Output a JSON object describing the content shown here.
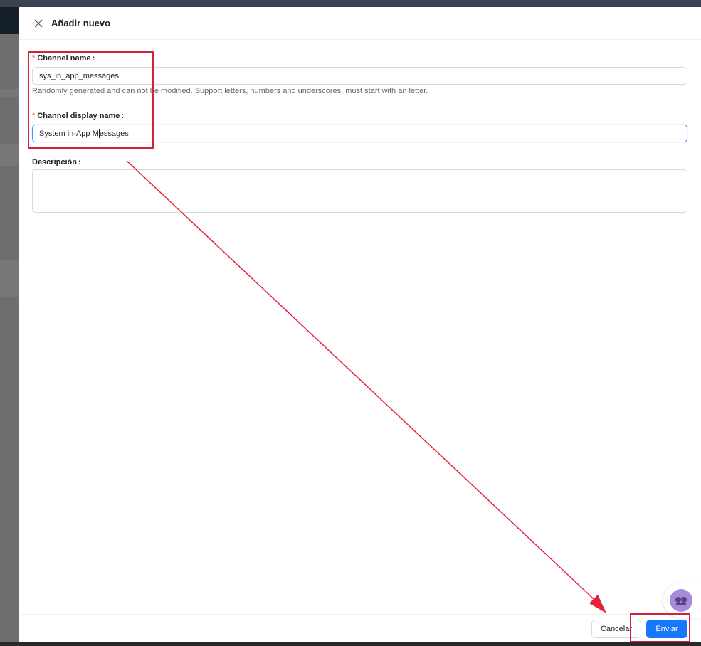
{
  "drawer": {
    "title": "Añadir nuevo",
    "close_icon": "close-icon"
  },
  "form": {
    "channel_name": {
      "label": "Channel name",
      "required": true,
      "value": "sys_in_app_messages",
      "help": "Randomly generated and can not be modified. Support letters, numbers and underscores, must start with an letter."
    },
    "channel_display_name": {
      "label": "Channel display name",
      "required": true,
      "value_before_caret": "System in-App M",
      "value_after_caret": "essages"
    },
    "description": {
      "label": "Descripción",
      "value": ""
    }
  },
  "footer": {
    "cancel_label": "Cancelar",
    "submit_label": "Enviar"
  },
  "colors": {
    "primary": "#1677ff",
    "required": "#ff4d4f",
    "annotation": "#d4203a"
  }
}
